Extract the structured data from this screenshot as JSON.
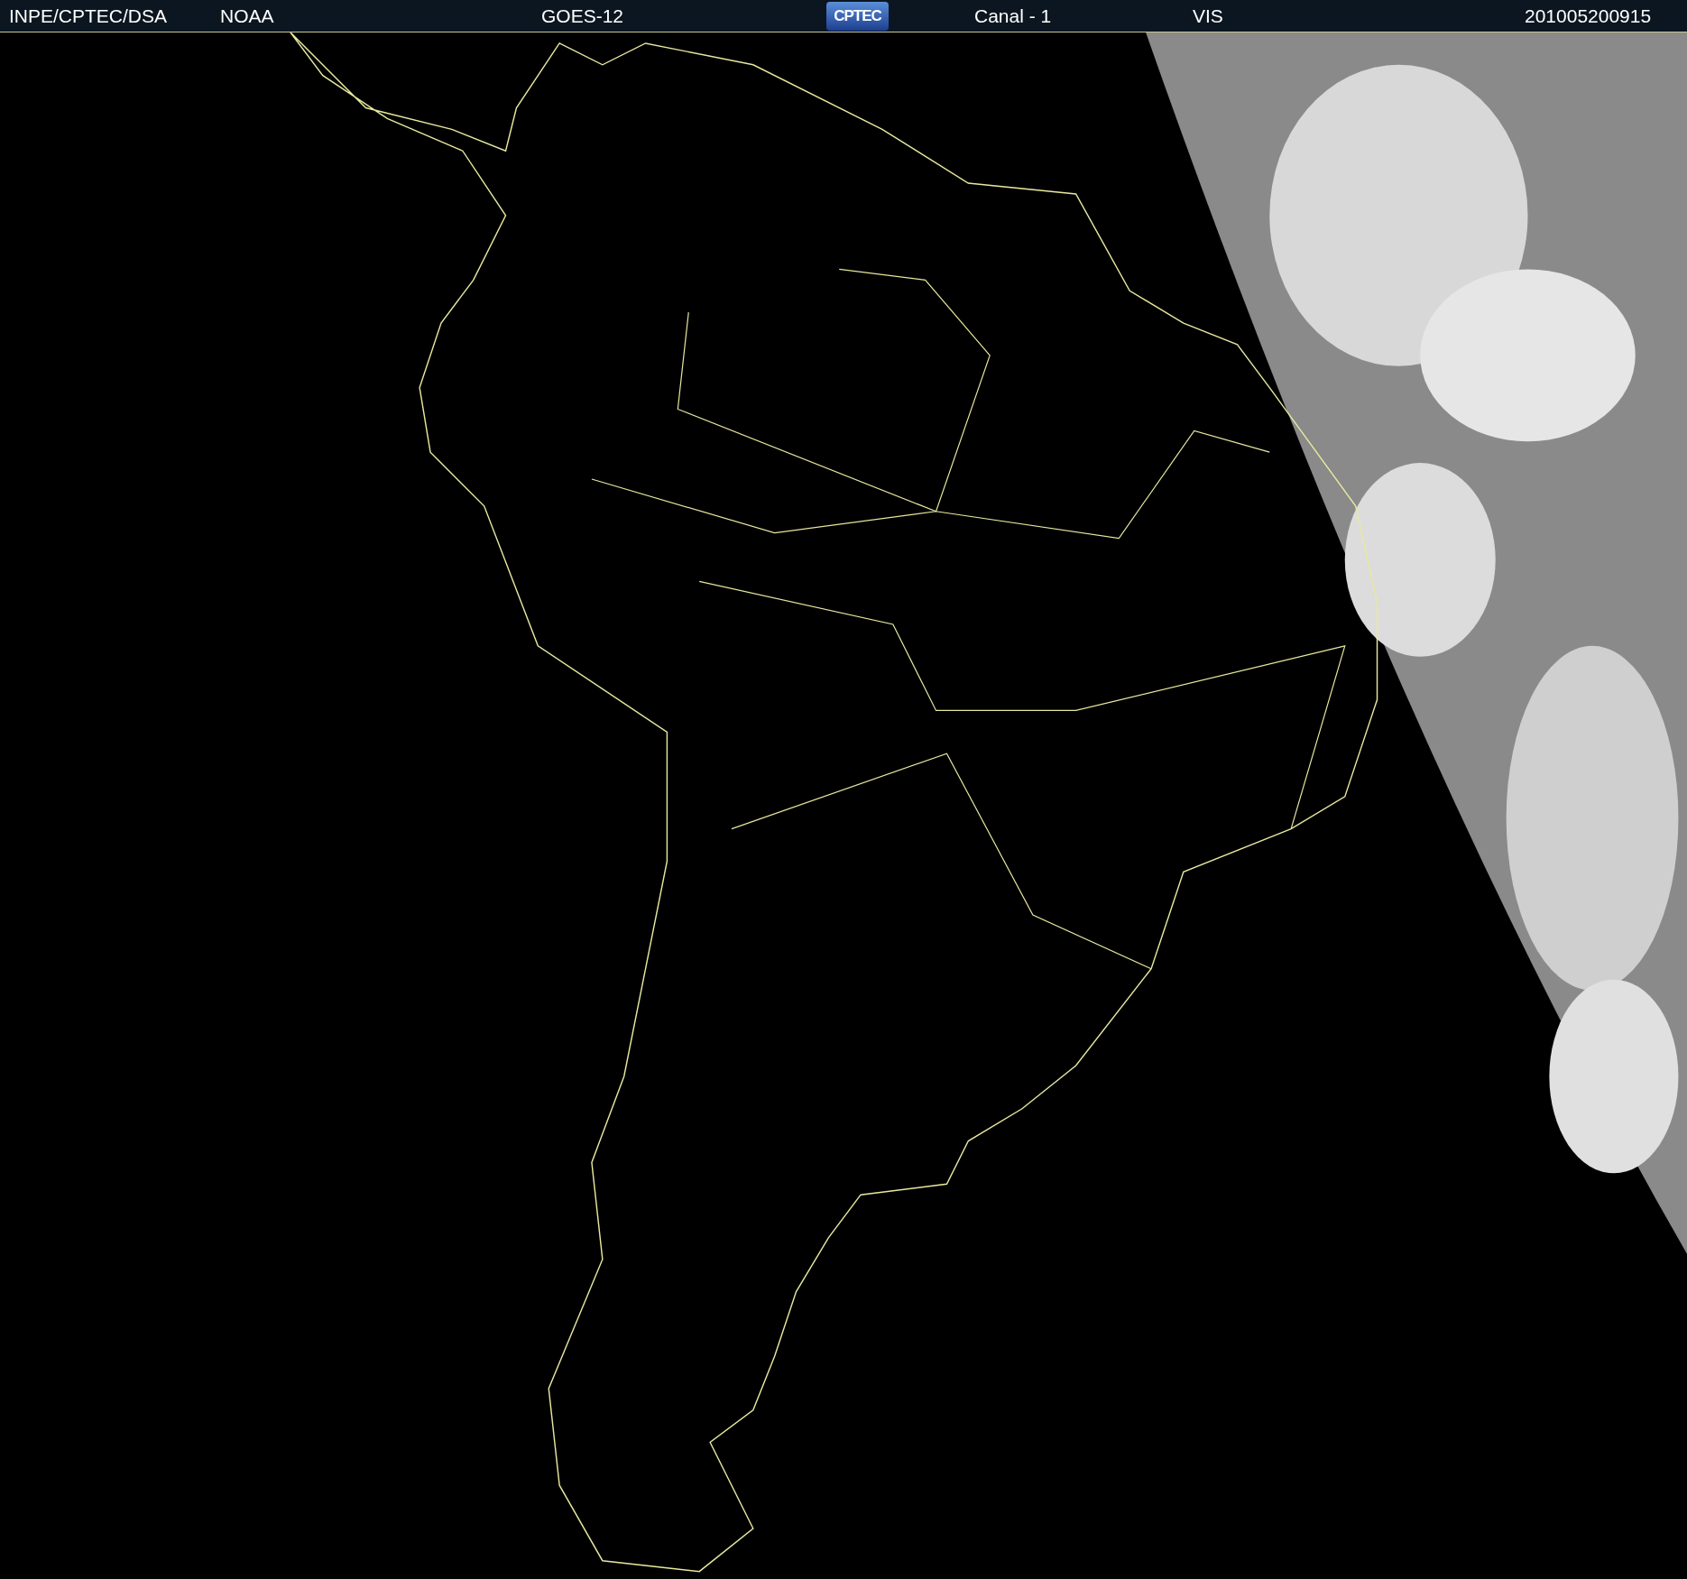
{
  "header": {
    "items": [
      {
        "kind": "text",
        "text": "INPE/CPTEC/DSA"
      },
      {
        "kind": "text",
        "text": "NOAA"
      },
      {
        "kind": "text",
        "text": "GOES-12"
      },
      {
        "kind": "logo",
        "text": "CPTEC"
      },
      {
        "kind": "text",
        "text": "Canal - 1"
      },
      {
        "kind": "text",
        "text": "VIS"
      },
      {
        "kind": "text",
        "text": "201005200915"
      }
    ]
  }
}
